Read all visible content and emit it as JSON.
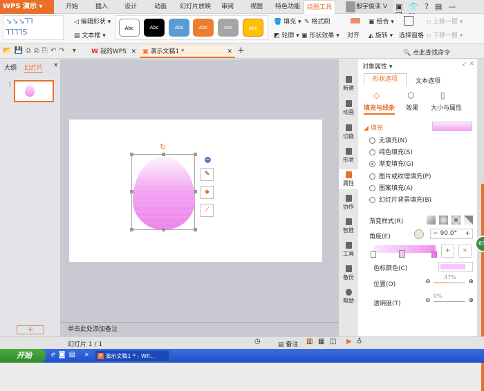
{
  "app": {
    "menu_button": "WPS 演示",
    "accent": "#e8702a"
  },
  "ribbon_tabs": [
    "开始",
    "插入",
    "设计",
    "动画",
    "幻灯片放映",
    "审阅",
    "视图",
    "特色功能",
    "绘图工具"
  ],
  "active_tab": "绘图工具",
  "user": {
    "name": "殷宇俊亚 V"
  },
  "ribbon": {
    "edit_shape": "编辑形状",
    "text_box": "文本框",
    "style_samples": [
      "Abc",
      "Abc",
      "Abc",
      "Abc",
      "Abc",
      "Abc"
    ],
    "fill": "填充",
    "format_painter": "格式刷",
    "outline": "轮廓",
    "shape_effects": "形状效果",
    "align": "对齐",
    "group": "组合",
    "rotate": "旋转",
    "selection_pane": "选择窗格",
    "bring_forward": "上移一层",
    "send_backward": "下移一层"
  },
  "doc_tabs": [
    {
      "label": "我的WPS"
    },
    {
      "label": "演示文稿1 *"
    }
  ],
  "search_command": "点此查找命令",
  "left_panel": {
    "tab_outline": "大纲",
    "tab_slides": "幻灯片",
    "slide_number": "1"
  },
  "notes_placeholder": "单击此处添加备注",
  "side_tools": [
    "新建",
    "动画",
    "切换",
    "形状",
    "属性",
    "协作",
    "智推",
    "工具",
    "备份",
    "帮助"
  ],
  "props": {
    "title": "对象属性",
    "tab_shape": "形状选项",
    "tab_text": "文本选项",
    "sub_fill_line": "填充与线条",
    "sub_effects": "效果",
    "sub_size": "大小与属性",
    "section_fill": "填充",
    "fill_options": [
      {
        "label": "无填充(N)",
        "checked": false
      },
      {
        "label": "纯色填充(S)",
        "checked": false
      },
      {
        "label": "渐变填充(G)",
        "checked": true
      },
      {
        "label": "图片或纹理填充(P)",
        "checked": false
      },
      {
        "label": "图案填充(A)",
        "checked": false
      },
      {
        "label": "幻灯片背景填充(B)",
        "checked": false
      }
    ],
    "gradient_style": "渐变样式(R)",
    "angle_label": "角度(E)",
    "angle_value": "90.0°",
    "stop_color": "色标颜色(C)",
    "position_label": "位置(O)",
    "position_value": "47%",
    "transparency_label": "透明度(T)",
    "transparency_value": "0%",
    "gradient_color": "#f7a8f7"
  },
  "badge": "65",
  "status": {
    "slide_info": "幻灯片 1 / 1",
    "notes": "备注"
  },
  "taskbar": {
    "start": "开始",
    "window": "演示文稿1 * - WP..."
  }
}
